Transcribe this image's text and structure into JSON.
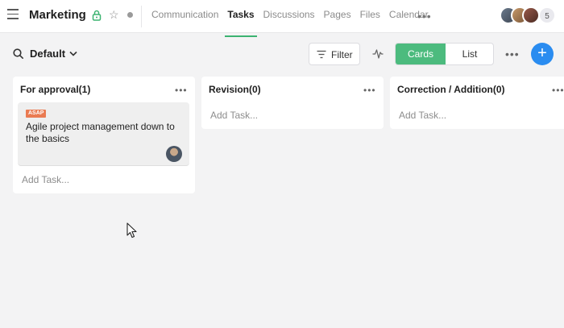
{
  "header": {
    "title": "Marketing",
    "tabs": [
      {
        "label": "Communication",
        "active": false
      },
      {
        "label": "Tasks",
        "active": true
      },
      {
        "label": "Discussions",
        "active": false
      },
      {
        "label": "Pages",
        "active": false
      },
      {
        "label": "Files",
        "active": false
      },
      {
        "label": "Calendar",
        "active": false
      }
    ],
    "more_label": "•••",
    "member_count": "5"
  },
  "toolbar": {
    "view_label": "Default",
    "filter_label": "Filter",
    "cards_label": "Cards",
    "list_label": "List",
    "more_label": "•••",
    "add_label": "+"
  },
  "columns": [
    {
      "title": "For approval(1)",
      "add_task": "Add Task...",
      "more_label": "•••",
      "cards": [
        {
          "badge": "ASAP",
          "title": "Agile project management down to the basics"
        }
      ]
    },
    {
      "title": "Revision(0)",
      "add_task": "Add Task...",
      "more_label": "•••",
      "cards": []
    },
    {
      "title": "Correction / Addition(0)",
      "add_task": "Add Task...",
      "more_label": "•••",
      "cards": []
    }
  ],
  "colors": {
    "accent_green": "#4cbb7e",
    "primary_blue": "#2a8cf0",
    "badge_orange": "#ea7b52"
  }
}
